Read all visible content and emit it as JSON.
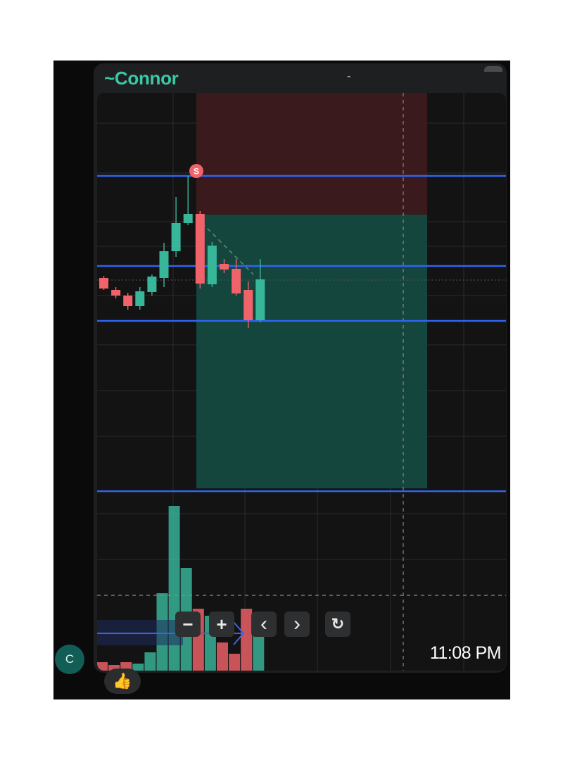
{
  "message": {
    "sender": "~Connor",
    "header_mark": "-",
    "timestamp": "11:08 PM",
    "avatar_initial": "C",
    "reaction": "👍"
  },
  "chart_controls": [
    {
      "name": "zoom-out-button",
      "icon": "minus-icon",
      "glyph": "−"
    },
    {
      "name": "zoom-in-button",
      "icon": "plus-icon",
      "glyph": "+"
    },
    {
      "name": "scroll-left-button",
      "icon": "chevron-left-icon",
      "glyph": "‹"
    },
    {
      "name": "scroll-right-button",
      "icon": "chevron-right-icon",
      "glyph": "›"
    },
    {
      "name": "reset-button",
      "icon": "refresh-icon",
      "glyph": "↻"
    }
  ],
  "colors": {
    "sender": "#38c9a7",
    "bull": "#38b69a",
    "bear": "#f0636a",
    "level_line": "#2f64f1",
    "stop_zone": "#3a1a1d",
    "target_zone": "#15463d",
    "grid": "#2a2b2d",
    "chart_bg": "#131313"
  },
  "chart_data": {
    "type": "candlestick",
    "candles": [
      {
        "o": 395,
        "h": 392,
        "l": 412,
        "c": 410
      },
      {
        "o": 412,
        "h": 408,
        "l": 424,
        "c": 420
      },
      {
        "o": 420,
        "h": 416,
        "l": 440,
        "c": 435
      },
      {
        "o": 435,
        "h": 408,
        "l": 440,
        "c": 414
      },
      {
        "o": 415,
        "h": 390,
        "l": 420,
        "c": 393
      },
      {
        "o": 395,
        "h": 345,
        "l": 408,
        "c": 357
      },
      {
        "o": 357,
        "h": 280,
        "l": 365,
        "c": 317
      },
      {
        "o": 317,
        "h": 250,
        "l": 320,
        "c": 304
      },
      {
        "o": 304,
        "h": 300,
        "l": 410,
        "c": 403
      },
      {
        "o": 404,
        "h": 344,
        "l": 408,
        "c": 349
      },
      {
        "o": 375,
        "h": 368,
        "l": 388,
        "c": 383
      },
      {
        "o": 382,
        "h": 368,
        "l": 420,
        "c": 417
      },
      {
        "o": 412,
        "h": 400,
        "l": 466,
        "c": 455
      },
      {
        "o": 455,
        "h": 368,
        "l": 458,
        "c": 397
      }
    ],
    "level_lines": [
      250,
      378,
      456,
      698
    ],
    "position": {
      "type": "short",
      "stop": 250,
      "entry": 305,
      "target": 694
    },
    "sell_marker": "S",
    "volume": {
      "bars": [
        {
          "v": 12,
          "dir": "down"
        },
        {
          "v": 8,
          "dir": "down"
        },
        {
          "v": 12,
          "dir": "down"
        },
        {
          "v": 10,
          "dir": "up"
        },
        {
          "v": 26,
          "dir": "up"
        },
        {
          "v": 110,
          "dir": "up"
        },
        {
          "v": 234,
          "dir": "up"
        },
        {
          "v": 146,
          "dir": "up"
        },
        {
          "v": 88,
          "dir": "down"
        },
        {
          "v": 78,
          "dir": "up"
        },
        {
          "v": 40,
          "dir": "down"
        },
        {
          "v": 24,
          "dir": "down"
        },
        {
          "v": 88,
          "dir": "down"
        },
        {
          "v": 60,
          "dir": "up"
        }
      ]
    }
  }
}
